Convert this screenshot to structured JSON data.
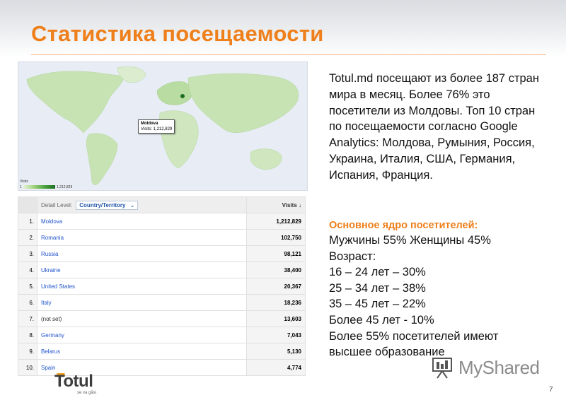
{
  "slide": {
    "title": "Статистика посещаемости",
    "page_number": "7",
    "accent_color": "#ee7f1a"
  },
  "map": {
    "tooltip_country": "Moldova",
    "tooltip_visits": "Visits: 1,212,829",
    "legend_title": "Visits",
    "legend_min": "1",
    "legend_max": "1,212,829"
  },
  "table": {
    "detail_label": "Detail Level:",
    "detail_select": "Country/Territory",
    "visits_header": "Visits",
    "rows": [
      {
        "num": "1.",
        "country": "Moldova",
        "visits": "1,212,829"
      },
      {
        "num": "2.",
        "country": "Romania",
        "visits": "102,750"
      },
      {
        "num": "3.",
        "country": "Russia",
        "visits": "98,121"
      },
      {
        "num": "4.",
        "country": "Ukraine",
        "visits": "38,400"
      },
      {
        "num": "5.",
        "country": "United States",
        "visits": "20,367"
      },
      {
        "num": "6.",
        "country": "Italy",
        "visits": "18,236"
      },
      {
        "num": "7.",
        "country": "(not set)",
        "visits": "13,603"
      },
      {
        "num": "8.",
        "country": "Germany",
        "visits": "7,043"
      },
      {
        "num": "9.",
        "country": "Belarus",
        "visits": "5,130"
      },
      {
        "num": "10.",
        "country": "Spain",
        "visits": "4,774"
      }
    ]
  },
  "description": "Totul.md посещают из более 187 стран мира в месяц. Более 76% это посетители из Молдовы. Топ 10 стран по посещаемости согласно Google Analytics: Молдова, Румыния, Россия, Украина, Италия, США, Германия, Испания, Франция.",
  "core": {
    "heading": "Основное ядро посетителей:",
    "lines": [
      "Мужчины 55% Женщины 45%",
      "Возраст:",
      "16 – 24 лет – 30%",
      "25 – 34 лет – 38%",
      "35 – 45 лет – 22%",
      "Более 45 лет  - 10%",
      "Более 55% посетителей имеют",
      "высшее образование"
    ]
  },
  "logo": {
    "word": "Totul",
    "tag": "se va găsi"
  },
  "watermark": {
    "text": "MyShared",
    "icon": "presentation-board-icon"
  }
}
